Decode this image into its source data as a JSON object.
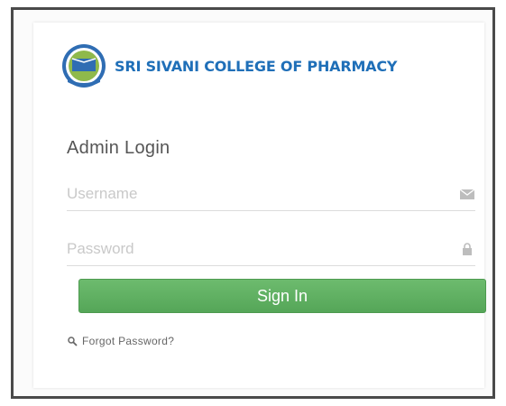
{
  "brand": {
    "name": "SRI SIVANI COLLEGE OF PHARMACY",
    "color": "#1f6fb8"
  },
  "login": {
    "title": "Admin Login",
    "username_placeholder": "Username",
    "username_icon": "envelope-icon",
    "password_placeholder": "Password",
    "password_icon": "lock-icon",
    "submit_label": "Sign In",
    "submit_color": "#5cb85c",
    "forgot_label": "Forgot Password?",
    "forgot_icon": "search-icon"
  }
}
